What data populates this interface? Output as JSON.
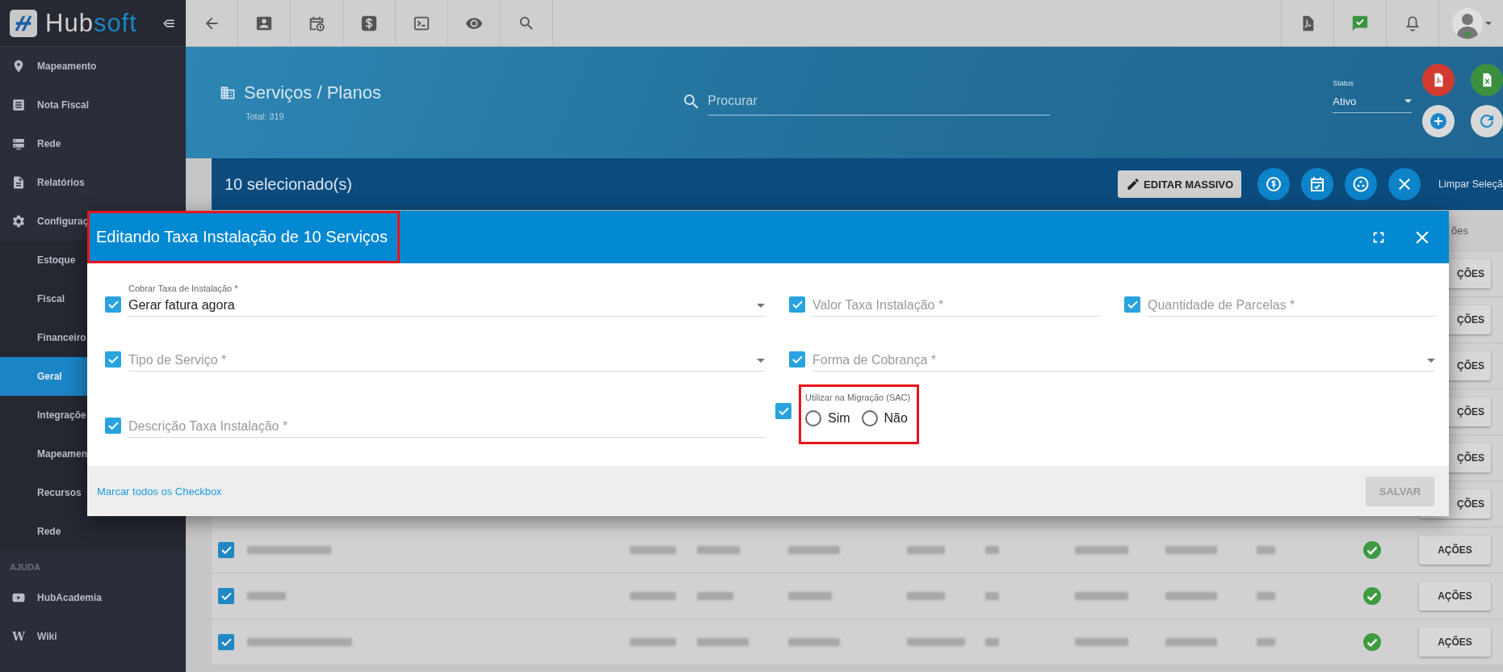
{
  "sidebar": {
    "logo": {
      "text": "Hub",
      "accent": "soft"
    },
    "items": [
      {
        "label": "Mapeamento",
        "selected": false
      },
      {
        "label": "Nota Fiscal",
        "selected": false
      },
      {
        "label": "Rede",
        "selected": false
      },
      {
        "label": "Relatórios",
        "selected": false
      },
      {
        "label": "Configuraç",
        "selected": false,
        "children": [
          {
            "label": "Estoque",
            "selected": false
          },
          {
            "label": "Fiscal",
            "selected": false
          },
          {
            "label": "Financeiro",
            "selected": false
          },
          {
            "label": "Geral",
            "selected": true
          },
          {
            "label": "Integraçõe",
            "selected": false
          },
          {
            "label": "Mapeamen",
            "selected": false
          },
          {
            "label": "Recursos",
            "selected": false
          },
          {
            "label": "Rede",
            "selected": false
          }
        ]
      }
    ],
    "sections": [
      {
        "title": "AJUDA",
        "items": [
          {
            "label": "HubAcademia",
            "selected": false
          },
          {
            "label": "Wiki",
            "glyph": "W",
            "selected": false
          }
        ]
      }
    ]
  },
  "header": {
    "title": "Serviços / Planos",
    "total": "Total: 319",
    "search": {
      "placeholder": "Procurar"
    },
    "status": {
      "label": "Status",
      "value": "Ativo"
    }
  },
  "selection_bar": {
    "count": "10 selecionado(s)",
    "edit_button": "EDITAR MASSIVO",
    "clear": "Limpar Seleçã"
  },
  "table": {
    "column_header": "ões",
    "rows_behind_dialog": [
      {
        "action": "ÇÕES"
      },
      {
        "action": "ÇÕES"
      },
      {
        "action": "ÇÕES"
      },
      {
        "action": "ÇÕES"
      },
      {
        "action": "ÇÕES"
      },
      {
        "action": "ÇÕES"
      }
    ],
    "rows": [
      {
        "checked": true,
        "active": true,
        "action": "AÇÕES"
      },
      {
        "checked": true,
        "active": true,
        "action": "AÇÕES"
      },
      {
        "checked": true,
        "active": true,
        "action": "AÇÕES"
      }
    ]
  },
  "dialog": {
    "title": "Editando Taxa Instalação de 10 Serviços",
    "title_highlighted": true,
    "rows": [
      {
        "fields": [
          {
            "kind": "select",
            "label": "Cobrar Taxa de Instalação *",
            "value": "Gerar fatura agora",
            "checked": true
          },
          {
            "kind": "input",
            "placeholder": "Valor Taxa Instalação *",
            "checked": true
          },
          {
            "kind": "input",
            "placeholder": "Quantidade de Parcelas *",
            "checked": true
          }
        ]
      },
      {
        "fields": [
          {
            "kind": "select",
            "placeholder": "Tipo de Serviço *",
            "checked": true
          },
          {
            "kind": "select",
            "placeholder": "Forma de Cobrança *",
            "checked": true
          }
        ]
      },
      {
        "fields": [
          {
            "kind": "input",
            "placeholder": "Descrição Taxa Instalação *",
            "checked": true
          },
          {
            "kind": "radio",
            "label": "Utilizar na Migração (SAC)",
            "checked": true,
            "highlighted": true,
            "options": [
              {
                "label": "Sim",
                "selected": false
              },
              {
                "label": "Não",
                "selected": false
              }
            ]
          }
        ]
      }
    ],
    "footer_link": "Marcar todos os Checkbox",
    "save": {
      "label": "SALVAR",
      "disabled": true
    }
  }
}
